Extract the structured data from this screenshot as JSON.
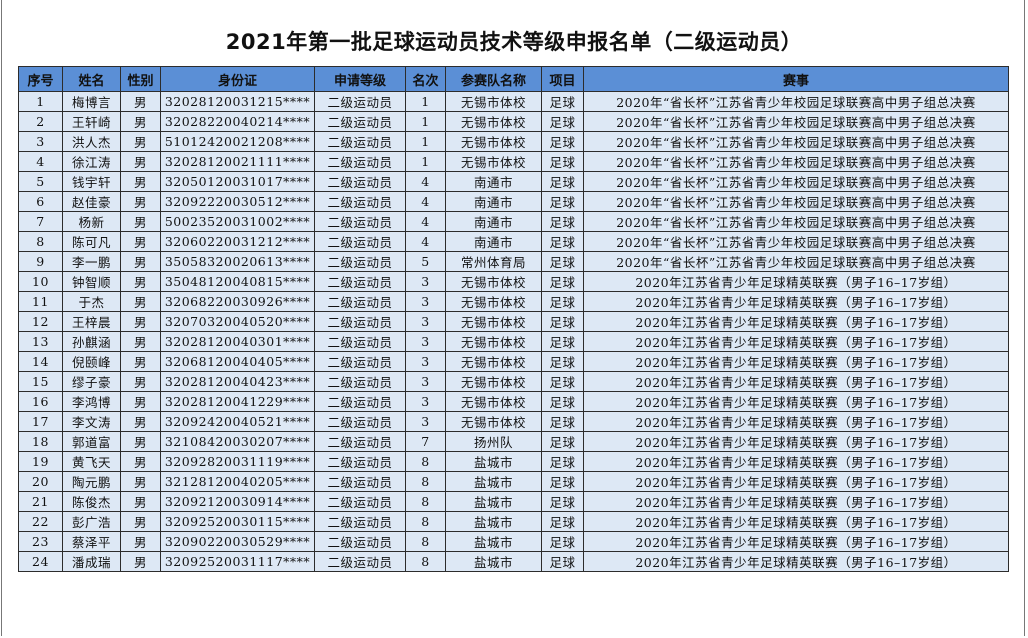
{
  "document": {
    "title": "2021年第一批足球运动员技术等级申报名单（二级运动员）"
  },
  "table": {
    "headers": [
      "序号",
      "姓名",
      "性别",
      "身份证",
      "申请等级",
      "名次",
      "参赛队名称",
      "项目",
      "赛事"
    ],
    "rows": [
      [
        "1",
        "梅博言",
        "男",
        "32028120031215****",
        "二级运动员",
        "1",
        "无锡市体校",
        "足球",
        "2020年“省长杯”江苏省青少年校园足球联赛高中男子组总决赛"
      ],
      [
        "2",
        "王轩崎",
        "男",
        "32028220040214****",
        "二级运动员",
        "1",
        "无锡市体校",
        "足球",
        "2020年“省长杯”江苏省青少年校园足球联赛高中男子组总决赛"
      ],
      [
        "3",
        "洪人杰",
        "男",
        "51012420021208****",
        "二级运动员",
        "1",
        "无锡市体校",
        "足球",
        "2020年“省长杯”江苏省青少年校园足球联赛高中男子组总决赛"
      ],
      [
        "4",
        "徐江涛",
        "男",
        "32028120021111****",
        "二级运动员",
        "1",
        "无锡市体校",
        "足球",
        "2020年“省长杯”江苏省青少年校园足球联赛高中男子组总决赛"
      ],
      [
        "5",
        "钱宇轩",
        "男",
        "32050120031017****",
        "二级运动员",
        "4",
        "南通市",
        "足球",
        "2020年“省长杯”江苏省青少年校园足球联赛高中男子组总决赛"
      ],
      [
        "6",
        "赵佳豪",
        "男",
        "32092220030512****",
        "二级运动员",
        "4",
        "南通市",
        "足球",
        "2020年“省长杯”江苏省青少年校园足球联赛高中男子组总决赛"
      ],
      [
        "7",
        "杨新",
        "男",
        "50023520031002****",
        "二级运动员",
        "4",
        "南通市",
        "足球",
        "2020年“省长杯”江苏省青少年校园足球联赛高中男子组总决赛"
      ],
      [
        "8",
        "陈可凡",
        "男",
        "32060220031212****",
        "二级运动员",
        "4",
        "南通市",
        "足球",
        "2020年“省长杯”江苏省青少年校园足球联赛高中男子组总决赛"
      ],
      [
        "9",
        "李一鹏",
        "男",
        "35058320020613****",
        "二级运动员",
        "5",
        "常州体育局",
        "足球",
        "2020年“省长杯”江苏省青少年校园足球联赛高中男子组总决赛"
      ],
      [
        "10",
        "钟智顺",
        "男",
        "35048120040815****",
        "二级运动员",
        "3",
        "无锡市体校",
        "足球",
        "2020年江苏省青少年足球精英联赛（男子16–17岁组）"
      ],
      [
        "11",
        "于杰",
        "男",
        "32068220030926****",
        "二级运动员",
        "3",
        "无锡市体校",
        "足球",
        "2020年江苏省青少年足球精英联赛（男子16–17岁组）"
      ],
      [
        "12",
        "王梓晨",
        "男",
        "32070320040520****",
        "二级运动员",
        "3",
        "无锡市体校",
        "足球",
        "2020年江苏省青少年足球精英联赛（男子16–17岁组）"
      ],
      [
        "13",
        "孙麒涵",
        "男",
        "32028120040301****",
        "二级运动员",
        "3",
        "无锡市体校",
        "足球",
        "2020年江苏省青少年足球精英联赛（男子16–17岁组）"
      ],
      [
        "14",
        "倪颐峰",
        "男",
        "32068120040405****",
        "二级运动员",
        "3",
        "无锡市体校",
        "足球",
        "2020年江苏省青少年足球精英联赛（男子16–17岁组）"
      ],
      [
        "15",
        "缪子豪",
        "男",
        "32028120040423****",
        "二级运动员",
        "3",
        "无锡市体校",
        "足球",
        "2020年江苏省青少年足球精英联赛（男子16–17岁组）"
      ],
      [
        "16",
        "李鸿博",
        "男",
        "32028120041229****",
        "二级运动员",
        "3",
        "无锡市体校",
        "足球",
        "2020年江苏省青少年足球精英联赛（男子16–17岁组）"
      ],
      [
        "17",
        "李文涛",
        "男",
        "32092420040521****",
        "二级运动员",
        "3",
        "无锡市体校",
        "足球",
        "2020年江苏省青少年足球精英联赛（男子16–17岁组）"
      ],
      [
        "18",
        "郭道富",
        "男",
        "32108420030207****",
        "二级运动员",
        "7",
        "扬州队",
        "足球",
        "2020年江苏省青少年足球精英联赛（男子16–17岁组）"
      ],
      [
        "19",
        "黄飞天",
        "男",
        "32092820031119****",
        "二级运动员",
        "8",
        "盐城市",
        "足球",
        "2020年江苏省青少年足球精英联赛（男子16–17岁组）"
      ],
      [
        "20",
        "陶元鹏",
        "男",
        "32128120040205****",
        "二级运动员",
        "8",
        "盐城市",
        "足球",
        "2020年江苏省青少年足球精英联赛（男子16–17岁组）"
      ],
      [
        "21",
        "陈俊杰",
        "男",
        "32092120030914****",
        "二级运动员",
        "8",
        "盐城市",
        "足球",
        "2020年江苏省青少年足球精英联赛（男子16–17岁组）"
      ],
      [
        "22",
        "彭广浩",
        "男",
        "32092520030115****",
        "二级运动员",
        "8",
        "盐城市",
        "足球",
        "2020年江苏省青少年足球精英联赛（男子16–17岁组）"
      ],
      [
        "23",
        "蔡泽平",
        "男",
        "32090220030529****",
        "二级运动员",
        "8",
        "盐城市",
        "足球",
        "2020年江苏省青少年足球精英联赛（男子16–17岁组）"
      ],
      [
        "24",
        "潘成瑞",
        "男",
        "32092520031117****",
        "二级运动员",
        "8",
        "盐城市",
        "足球",
        "2020年江苏省青少年足球精英联赛（男子16–17岁组）"
      ]
    ]
  },
  "colors": {
    "header_background": "#5b8fd6",
    "row_background": "#dde8f5",
    "border": "#2c2c2c"
  }
}
